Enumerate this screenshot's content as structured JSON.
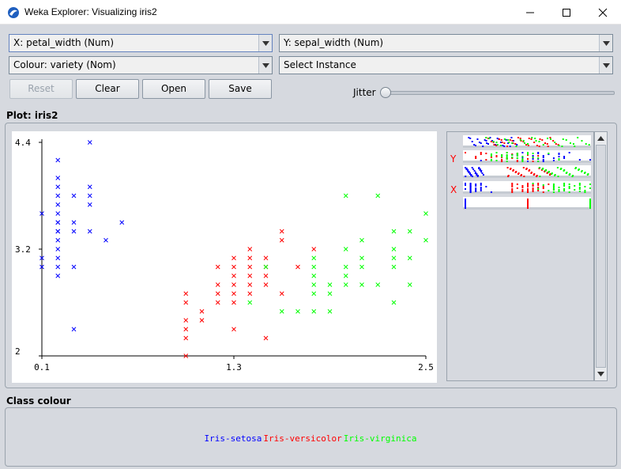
{
  "window": {
    "title": "Weka Explorer: Visualizing iris2",
    "minimize_icon": "minimize-icon",
    "maximize_icon": "maximize-icon",
    "close_icon": "close-icon"
  },
  "controls": {
    "x_axis": "X:  petal_width (Num)",
    "y_axis": "Y: sepal_width (Num)",
    "colour": "Colour:  variety (Nom)",
    "select_instance": "Select Instance",
    "reset_label": "Reset",
    "clear_label": "Clear",
    "open_label": "Open",
    "save_label": "Save",
    "jitter_label": "Jitter",
    "jitter_value": 0
  },
  "plot": {
    "section_title": "Plot: iris2",
    "marker": "x",
    "x_ticks": [
      "0.1",
      "1.3",
      "2.5"
    ],
    "y_ticks": [
      "4.4",
      "3.2",
      "2"
    ]
  },
  "matrix": {
    "y_letter": "Y",
    "x_letter": "X"
  },
  "class_colour": {
    "section_title": "Class colour",
    "classes": [
      {
        "name": "Iris-setosa",
        "color": "#0000ff"
      },
      {
        "name": "Iris-versicolor",
        "color": "#ff0000"
      },
      {
        "name": "Iris-virginica",
        "color": "#00ff00"
      }
    ]
  },
  "chart_data": {
    "type": "scatter",
    "xlabel": "",
    "ylabel": "",
    "xlim": [
      0.1,
      2.5
    ],
    "ylim": [
      2.0,
      4.4
    ],
    "series": [
      {
        "name": "Iris-setosa",
        "color": "#0000ff",
        "points": [
          [
            0.1,
            3.1
          ],
          [
            0.1,
            3.0
          ],
          [
            0.1,
            3.6
          ],
          [
            0.2,
            3.5
          ],
          [
            0.2,
            3.0
          ],
          [
            0.2,
            3.2
          ],
          [
            0.2,
            3.1
          ],
          [
            0.2,
            3.4
          ],
          [
            0.2,
            3.3
          ],
          [
            0.2,
            2.9
          ],
          [
            0.2,
            3.7
          ],
          [
            0.2,
            3.8
          ],
          [
            0.2,
            4.0
          ],
          [
            0.2,
            3.9
          ],
          [
            0.2,
            3.6
          ],
          [
            0.2,
            4.2
          ],
          [
            0.2,
            3.5
          ],
          [
            0.2,
            3.4
          ],
          [
            0.3,
            3.5
          ],
          [
            0.3,
            3.8
          ],
          [
            0.3,
            3.4
          ],
          [
            0.3,
            3.0
          ],
          [
            0.3,
            2.3
          ],
          [
            0.4,
            3.9
          ],
          [
            0.4,
            3.4
          ],
          [
            0.4,
            3.7
          ],
          [
            0.4,
            3.8
          ],
          [
            0.4,
            4.4
          ],
          [
            0.5,
            3.3
          ],
          [
            0.6,
            3.5
          ]
        ]
      },
      {
        "name": "Iris-versicolor",
        "color": "#ff0000",
        "points": [
          [
            1.0,
            2.0
          ],
          [
            1.0,
            2.2
          ],
          [
            1.0,
            2.3
          ],
          [
            1.0,
            2.4
          ],
          [
            1.0,
            2.6
          ],
          [
            1.0,
            2.7
          ],
          [
            1.1,
            2.5
          ],
          [
            1.1,
            2.4
          ],
          [
            1.2,
            2.8
          ],
          [
            1.2,
            2.7
          ],
          [
            1.2,
            3.0
          ],
          [
            1.2,
            2.6
          ],
          [
            1.3,
            2.3
          ],
          [
            1.3,
            2.8
          ],
          [
            1.3,
            2.9
          ],
          [
            1.3,
            2.7
          ],
          [
            1.3,
            2.6
          ],
          [
            1.3,
            3.0
          ],
          [
            1.4,
            2.9
          ],
          [
            1.4,
            3.0
          ],
          [
            1.4,
            2.8
          ],
          [
            1.4,
            2.7
          ],
          [
            1.4,
            3.1
          ],
          [
            1.5,
            2.2
          ],
          [
            1.5,
            2.8
          ],
          [
            1.5,
            2.9
          ],
          [
            1.5,
            3.0
          ],
          [
            1.5,
            3.1
          ],
          [
            1.6,
            3.4
          ],
          [
            1.6,
            3.3
          ],
          [
            1.6,
            2.7
          ],
          [
            1.7,
            3.0
          ],
          [
            1.8,
            3.2
          ],
          [
            1.4,
            3.2
          ],
          [
            1.3,
            3.1
          ]
        ]
      },
      {
        "name": "Iris-virginica",
        "color": "#00ff00",
        "points": [
          [
            1.4,
            2.6
          ],
          [
            1.5,
            3.0
          ],
          [
            1.6,
            2.5
          ],
          [
            1.7,
            2.5
          ],
          [
            1.8,
            2.5
          ],
          [
            1.8,
            2.8
          ],
          [
            1.8,
            2.9
          ],
          [
            1.8,
            3.0
          ],
          [
            1.8,
            3.1
          ],
          [
            1.8,
            2.7
          ],
          [
            1.9,
            2.5
          ],
          [
            1.9,
            2.7
          ],
          [
            2.0,
            2.8
          ],
          [
            2.0,
            3.0
          ],
          [
            2.0,
            3.2
          ],
          [
            2.0,
            3.8
          ],
          [
            2.1,
            3.0
          ],
          [
            2.1,
            3.1
          ],
          [
            2.1,
            2.8
          ],
          [
            2.1,
            3.3
          ],
          [
            2.2,
            3.8
          ],
          [
            2.2,
            2.8
          ],
          [
            2.3,
            2.6
          ],
          [
            2.3,
            3.1
          ],
          [
            2.3,
            3.2
          ],
          [
            2.3,
            3.4
          ],
          [
            2.3,
            3.0
          ],
          [
            2.4,
            3.1
          ],
          [
            2.4,
            2.8
          ],
          [
            2.4,
            3.4
          ],
          [
            2.5,
            3.3
          ],
          [
            2.5,
            3.6
          ],
          [
            1.9,
            2.8
          ],
          [
            2.0,
            2.9
          ]
        ]
      }
    ]
  }
}
